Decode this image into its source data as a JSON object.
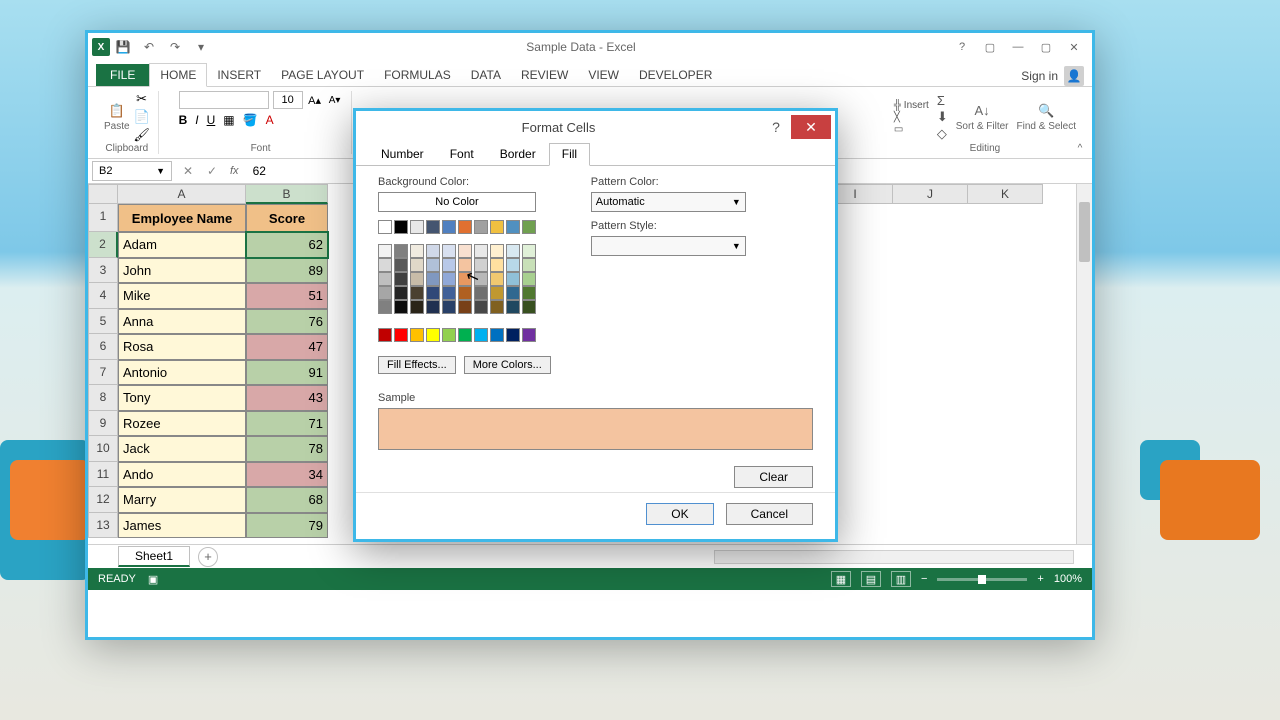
{
  "titlebar": {
    "title": "Sample Data - Excel"
  },
  "win": {
    "help": "?",
    "restore": "▢",
    "min": "—",
    "close": "✕"
  },
  "signin": {
    "label": "Sign in"
  },
  "tabs": {
    "file": "FILE",
    "home": "HOME",
    "insert": "INSERT",
    "pagelayout": "PAGE LAYOUT",
    "formulas": "FORMULAS",
    "data": "DATA",
    "review": "REVIEW",
    "view": "VIEW",
    "developer": "DEVELOPER"
  },
  "ribbon": {
    "paste": "Paste",
    "clipboard": "Clipboard",
    "font": "Font",
    "font_size": "10",
    "insert": "Insert",
    "sortfilter": "Sort & Filter",
    "findselect": "Find & Select",
    "editing": "Editing"
  },
  "formula": {
    "namebox": "B2",
    "fx": "fx",
    "value": "62"
  },
  "cols": [
    "A",
    "B",
    "I",
    "J",
    "K"
  ],
  "rows": [
    "1",
    "2",
    "3",
    "4",
    "5",
    "6",
    "7",
    "8",
    "9",
    "10",
    "11",
    "12",
    "13"
  ],
  "headers": {
    "name": "Employee Name",
    "score": "Score"
  },
  "data": [
    {
      "name": "Adam",
      "score": "62",
      "cls": "good"
    },
    {
      "name": "John",
      "score": "89",
      "cls": "good"
    },
    {
      "name": "Mike",
      "score": "51",
      "cls": "bad"
    },
    {
      "name": "Anna",
      "score": "76",
      "cls": "good"
    },
    {
      "name": "Rosa",
      "score": "47",
      "cls": "bad"
    },
    {
      "name": "Antonio",
      "score": "91",
      "cls": "good"
    },
    {
      "name": "Tony",
      "score": "43",
      "cls": "bad"
    },
    {
      "name": "Rozee",
      "score": "71",
      "cls": "good"
    },
    {
      "name": "Jack",
      "score": "78",
      "cls": "good"
    },
    {
      "name": "Ando",
      "score": "34",
      "cls": "bad"
    },
    {
      "name": "Marry",
      "score": "68",
      "cls": "good"
    },
    {
      "name": "James",
      "score": "79",
      "cls": "good"
    }
  ],
  "sheet": {
    "name": "Sheet1"
  },
  "status": {
    "ready": "READY",
    "zoom": "100%"
  },
  "dialog": {
    "title": "Format Cells",
    "tabs": {
      "number": "Number",
      "font": "Font",
      "border": "Border",
      "fill": "Fill"
    },
    "bg_label": "Background Color:",
    "no_color": "No Color",
    "fill_effects": "Fill Effects...",
    "more_colors": "More Colors...",
    "pattern_color": "Pattern Color:",
    "automatic": "Automatic",
    "pattern_style": "Pattern Style:",
    "sample": "Sample",
    "sample_color": "#f4c4a0",
    "clear": "Clear",
    "ok": "OK",
    "cancel": "Cancel"
  },
  "palette": {
    "theme_row": [
      "#ffffff",
      "#000000",
      "#e8e8e8",
      "#445570",
      "#5080c0",
      "#e07030",
      "#a0a0a0",
      "#f0c040",
      "#5090c0",
      "#70a050"
    ],
    "shades": [
      [
        "#f2f2f2",
        "#808080",
        "#f0ebe0",
        "#d0d8e8",
        "#d8e0f0",
        "#f8e0d0",
        "#e8e8e8",
        "#fff0d0",
        "#d8e8f0",
        "#e0f0d8"
      ],
      [
        "#d9d9d9",
        "#595959",
        "#e0d8c8",
        "#b0c0d8",
        "#b8c8e8",
        "#f4c4a0",
        "#d0d0d0",
        "#ffe0a0",
        "#b8d8e8",
        "#c8e0b8"
      ],
      [
        "#bfbfbf",
        "#404040",
        "#c8bca8",
        "#8098c0",
        "#90a8d8",
        "#e89860",
        "#b8b8b8",
        "#f0c870",
        "#90c0d8",
        "#a8d090"
      ],
      [
        "#a6a6a6",
        "#262626",
        "#4a4030",
        "#304878",
        "#406098",
        "#b06020",
        "#707070",
        "#c09830",
        "#306890",
        "#507830"
      ],
      [
        "#808080",
        "#0d0d0d",
        "#2a2418",
        "#203050",
        "#284068",
        "#784018",
        "#484848",
        "#806020",
        "#204860",
        "#385020"
      ]
    ],
    "standard": [
      "#c00000",
      "#ff0000",
      "#ffc000",
      "#ffff00",
      "#92d050",
      "#00b050",
      "#00b0f0",
      "#0070c0",
      "#002060",
      "#7030a0"
    ]
  }
}
